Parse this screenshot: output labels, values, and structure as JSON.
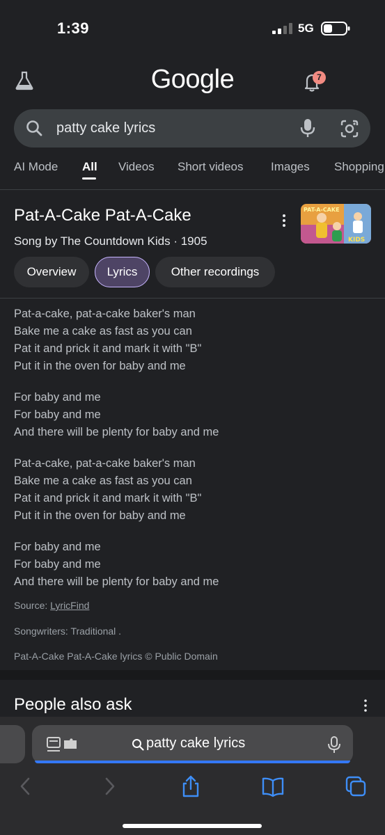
{
  "status_bar": {
    "time": "1:39",
    "network": "5G"
  },
  "header": {
    "logo": "Google",
    "notifications_count": "7"
  },
  "search": {
    "query": "patty cake lyrics"
  },
  "tabs": [
    {
      "label": "AI Mode"
    },
    {
      "label": "All",
      "active": true
    },
    {
      "label": "Videos"
    },
    {
      "label": "Short videos"
    },
    {
      "label": "Images"
    },
    {
      "label": "Shopping"
    }
  ],
  "song": {
    "title": "Pat-A-Cake Pat-A-Cake",
    "subtitle": "Song by The Countdown Kids · 1905",
    "thumbnail_text_top": "PAT-A-CAKE",
    "thumbnail_text_bottom": "KIDS"
  },
  "chips": [
    {
      "label": "Overview"
    },
    {
      "label": "Lyrics",
      "selected": true
    },
    {
      "label": "Other recordings"
    }
  ],
  "lyrics": [
    [
      "Pat-a-cake, pat-a-cake baker's man",
      "Bake me a cake as fast as you can",
      "Pat it and prick it and mark it with \"B\"",
      "Put it in the oven for baby and me"
    ],
    [
      "For baby and me",
      "For baby and me",
      "And there will be plenty for baby and me"
    ],
    [
      "Pat-a-cake, pat-a-cake baker's man",
      "Bake me a cake as fast as you can",
      "Pat it and prick it and mark it with \"B\"",
      "Put it in the oven for baby and me"
    ],
    [
      "For baby and me",
      "For baby and me",
      "And there will be plenty for baby and me"
    ]
  ],
  "meta": {
    "source_label": "Source: ",
    "source_link": "LyricFind",
    "songwriters": "Songwriters: Traditional .",
    "copyright": "Pat-A-Cake Pat-A-Cake lyrics © Public Domain"
  },
  "people_also_ask": {
    "title": "People also ask"
  },
  "browser": {
    "url_text": "patty cake lyrics"
  },
  "colors": {
    "background": "#202124",
    "accent": "#3478f6",
    "chip_selected": "#4e4465",
    "badge": "#f28b82"
  }
}
